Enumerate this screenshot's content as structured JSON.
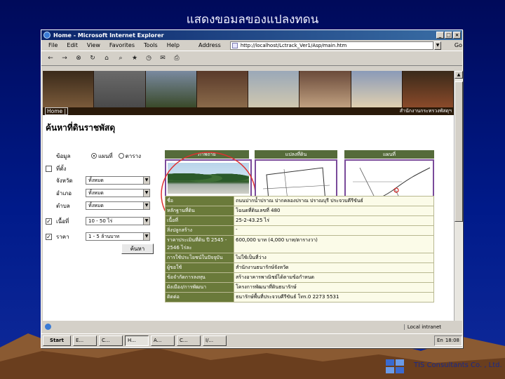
{
  "slide": {
    "title": "แสดงขอมลของแปลงทดน",
    "footer_brand": "TIS Consultants Co. , Ltd."
  },
  "window": {
    "title": "Home - Microsoft Internet Explorer",
    "buttons": [
      "_",
      "□",
      "×"
    ]
  },
  "menubar": {
    "items": [
      "File",
      "Edit",
      "View",
      "Favorites",
      "Tools",
      "Help"
    ],
    "address_label": "Address",
    "address_value": "http://localhost/Lctrack_Ver1/Asp/main.htm",
    "go_label": "Go"
  },
  "toolbar": {
    "icons": [
      "back-icon",
      "forward-icon",
      "stop-icon",
      "refresh-icon",
      "home-icon",
      "search-icon",
      "favorites-icon",
      "history-icon",
      "mail-icon",
      "print-icon"
    ]
  },
  "site": {
    "nav_home": "Home |",
    "agency": "สำนักงานกระทรวงพัสดุฯ"
  },
  "search": {
    "heading": "ค้นหาที่ดินราชพัสดุ",
    "data_label": "ข้อมูล",
    "radio_options": [
      "แผนที่",
      "ตาราง"
    ],
    "fields": [
      {
        "label": "ที่ตั้ง",
        "checked": false,
        "value": null
      },
      {
        "label": "จังหวัด",
        "checked": false,
        "value": "ทั้งหมด"
      },
      {
        "label": "อำเภอ",
        "checked": false,
        "value": "ทั้งหมด"
      },
      {
        "label": "ตำบล",
        "checked": false,
        "value": "ทั้งหมด"
      },
      {
        "label": "เนื้อที่",
        "checked": true,
        "value": "10 - 50 ไร่"
      },
      {
        "label": "ราคา",
        "checked": true,
        "value": "1 - 5 ล้านบาท"
      }
    ],
    "button_label": "ค้นหา"
  },
  "images": {
    "headers": [
      "ภาพถ่าย",
      "แปลงที่ดิน",
      "แผนที่"
    ]
  },
  "info_table": [
    {
      "key": "ชื่อ",
      "value": "ถนนปากน้ำปราณ ปากคลองปราณ ปราณบุรี ประจวบคีรีขันธ์"
    },
    {
      "key": "หลักฐานที่ดิน",
      "value": "โฉนดที่ดินเลขที่ 480"
    },
    {
      "key": "เนื้อที่",
      "value": "25-2-43.25 ไร่"
    },
    {
      "key": "สิ่งปลูกสร้าง",
      "value": "-"
    },
    {
      "key": "ราคาประเมินที่ดิน ปี 2545 - 2546 ไร่ละ",
      "value": "600,000 บาท (4,000 บาท/ตารางวา)"
    },
    {
      "key": "การใช้ประโยชน์ในปัจจุบัน",
      "value": "ไม่ใช้เป็นที่ว่าง"
    },
    {
      "key": "ผู้ขอใช้",
      "value": "สำนักงานธนารักษ์จังหวัด"
    },
    {
      "key": "ข้อจำกัดการลงทุน",
      "value": "สร้างอาคารพาณิชย์ได้ตามข้อกำหนด"
    },
    {
      "key": "ผังเมือง/การพัฒนา",
      "value": "โครงการพัฒนาที่ดินธนารักษ์"
    },
    {
      "key": "ติดต่อ",
      "value": "ธนารักษ์พื้นที่ประจวบคีรีขันธ์ โทร.0 2273 5531"
    }
  ],
  "statusbar": {
    "zone": "Local intranet"
  },
  "taskbar": {
    "start": "Start",
    "buttons": [
      "E...",
      "C...",
      "H...",
      "A...",
      "C...",
      "I/..."
    ],
    "active_index": 2,
    "tray_items": [
      "En",
      "18:08"
    ]
  },
  "colors": {
    "slide_bg": "#001a8a",
    "table_key_bg": "#6a7a3a",
    "photo_highlight": "#e03030"
  }
}
